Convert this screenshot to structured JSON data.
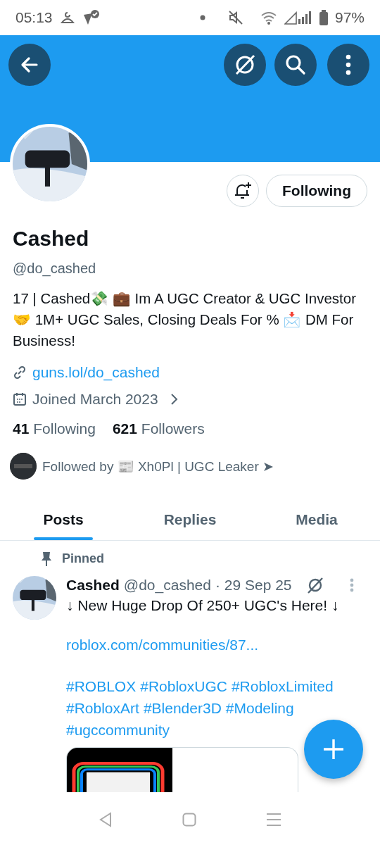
{
  "status_bar": {
    "time": "05:13",
    "battery": "97%"
  },
  "profile": {
    "name": "Cashed",
    "handle": "@do_cashed",
    "follow_button": "Following",
    "bio": "17 | Cashed💸 💼 Im A UGC Creator & UGC Investor 🤝 1M+ UGC Sales, Closing Deals For % 📩 DM For Business!",
    "link": "guns.lol/do_cashed",
    "joined": "Joined March 2023",
    "following_count": "41",
    "following_label": "Following",
    "followers_count": "621",
    "followers_label": "Followers",
    "followed_by": "Followed by 📰 Xh0Pl | UGC Leaker ➤"
  },
  "tabs": [
    {
      "label": "Posts",
      "selected": true
    },
    {
      "label": "Replies",
      "selected": false
    },
    {
      "label": "Media",
      "selected": false
    }
  ],
  "pinned_post": {
    "pinned_label": "Pinned",
    "author": "Cashed",
    "handle": "@do_cashed",
    "date": "· 29 Sep 25",
    "text": "↓ New Huge Drop Of 250+ UGC's Here! ↓",
    "link": "roblox.com/communities/87...",
    "hashtags": [
      "#ROBLOX",
      "#RobloxUGC",
      "#RobloxLimited",
      "#RobloxArt",
      "#Blender3D",
      "#Modeling",
      "#ugccommunity"
    ]
  }
}
